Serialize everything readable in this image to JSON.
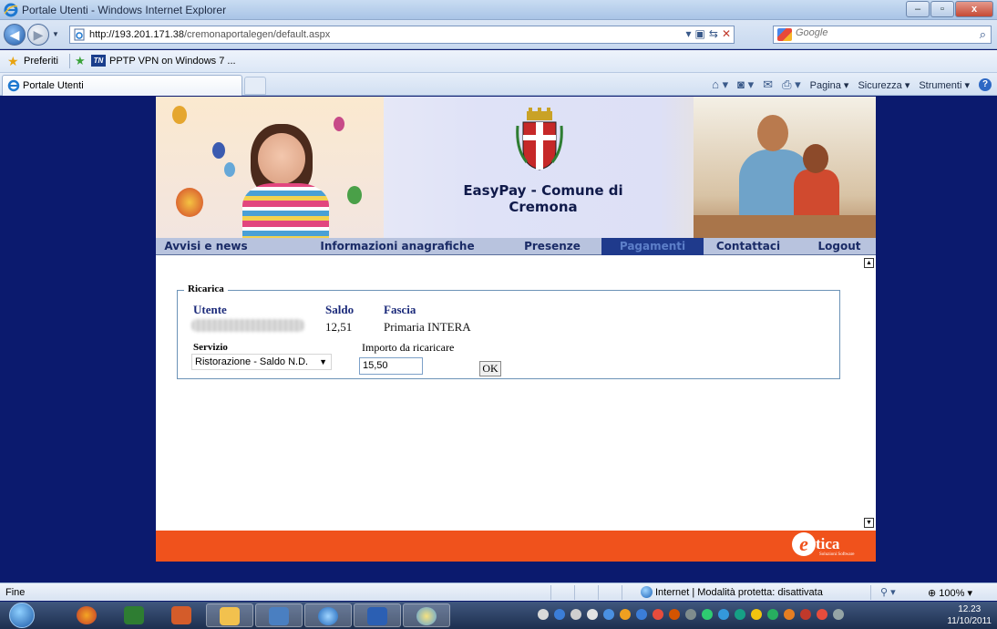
{
  "window": {
    "title": "Portale Utenti - Windows Internet Explorer",
    "minimize": "–",
    "maximize": "▫",
    "close": "x"
  },
  "address": {
    "url_host": "http://193.201.171.38",
    "url_path": "/cremonaportalegen/default.aspx",
    "search_placeholder": "Google"
  },
  "favorites": {
    "label": "Preferiti",
    "item_badge": "TN",
    "item": "PPTP VPN on Windows 7 ..."
  },
  "tab": {
    "label": "Portale Utenti"
  },
  "commandbar": {
    "items": [
      "Pagina ▾",
      "Sicurezza ▾",
      "Strumenti ▾"
    ]
  },
  "site": {
    "title": "EasyPay - Comune di Cremona",
    "nav": [
      "Avvisi e news",
      "Informazioni anagrafiche",
      "Presenze",
      "Pagamenti",
      "Contattaci",
      "Logout"
    ],
    "active_nav": "Pagamenti"
  },
  "ricarica": {
    "legend": "Ricarica",
    "headers": {
      "utente": "Utente",
      "saldo": "Saldo",
      "fascia": "Fascia"
    },
    "row": {
      "saldo": "12,51",
      "fascia": "Primaria INTERA"
    },
    "servizio_label": "Servizio",
    "servizio_value": "Ristorazione - Saldo N.D.",
    "importo_label": "Importo da ricaricare",
    "importo_value": "15,50",
    "ok_label": "OK"
  },
  "footer": {
    "brand_letter": "e",
    "brand": "tica",
    "tagline": "Soluzioni Software"
  },
  "status": {
    "text": "Fine",
    "zone": "Internet | Modalità protetta: disattivata",
    "zoom": "100%"
  },
  "clock": {
    "time": "12.23",
    "date": "11/10/2011"
  }
}
